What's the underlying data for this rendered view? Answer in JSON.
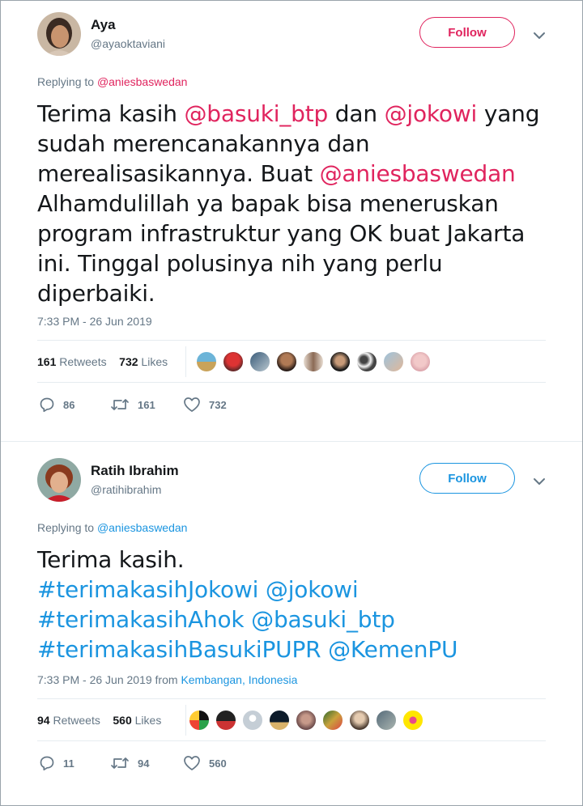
{
  "colors": {
    "link_pink": "#e0245e",
    "link_blue": "#1b95e0",
    "muted": "#657786",
    "text": "#14171a",
    "border": "#e6ecf0"
  },
  "tweets": [
    {
      "name": "Aya",
      "handle": "@ayaoktaviani",
      "follow_label": "Follow",
      "replying_prefix": "Replying to",
      "replying_to": "@aniesbaswedan",
      "body": {
        "l1a": "Terima kasih ",
        "l1b": "@basuki_btp",
        "l1c": " dan ",
        "l1d": "@jokowi",
        "l1e": " yang",
        "l2": "sudah merencanakannya dan",
        "l3a": "merealisasikannya. Buat ",
        "l3b": "@aniesbaswedan",
        "l4": "Alhamdulillah ya bapak bisa meneruskan",
        "l5": "program infrastruktur yang OK buat Jakarta",
        "l6": "ini. Tinggal polusinya nih yang perlu",
        "l7": "diperbaiki."
      },
      "timestamp": "7:33 PM - 26 Jun 2019",
      "retweets_count": "161",
      "retweets_label": "Retweets",
      "likes_count": "732",
      "likes_label": "Likes",
      "replies": "86",
      "retweet_action": "161",
      "like_action": "732"
    },
    {
      "name": "Ratih Ibrahim",
      "handle": "@ratihibrahim",
      "follow_label": "Follow",
      "replying_prefix": "Replying to",
      "replying_to": "@aniesbaswedan",
      "body": {
        "l1": "Terima kasih.",
        "l2a": "#terimakasihJokowi",
        "l2b": " @jokowi",
        "l3a": "#terimakasihAhok",
        "l3b": " @basuki_btp",
        "l4a": "#terimakasihBasukiPUPR",
        "l4b": " @KemenPU"
      },
      "timestamp": "7:33 PM - 26 Jun 2019 from ",
      "location": "Kembangan, Indonesia",
      "retweets_count": "94",
      "retweets_label": "Retweets",
      "likes_count": "560",
      "likes_label": "Likes",
      "replies": "11",
      "retweet_action": "94",
      "like_action": "560"
    }
  ]
}
